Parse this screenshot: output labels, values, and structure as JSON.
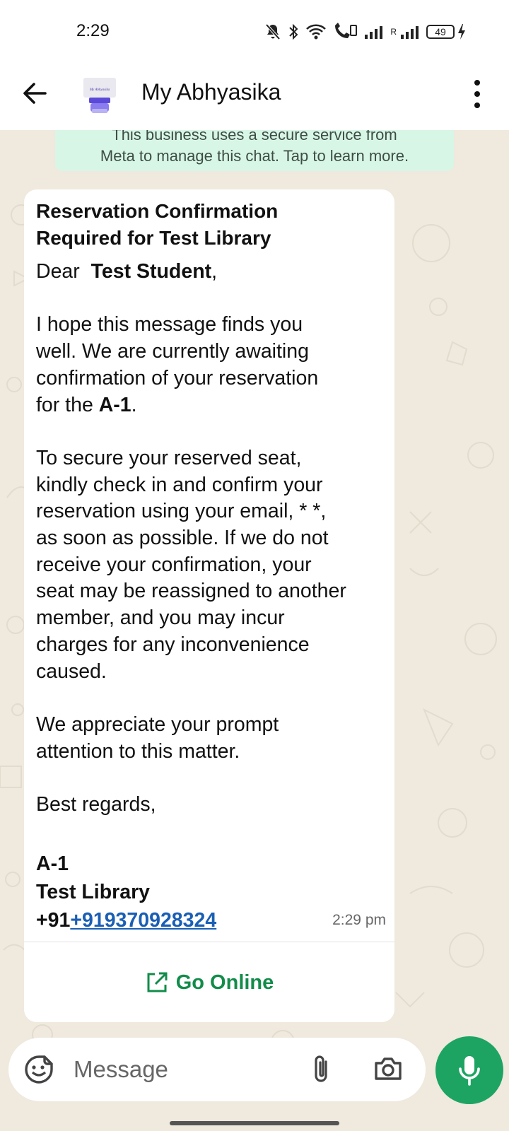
{
  "status_bar": {
    "time": "2:29",
    "battery": "49",
    "roaming_label": "R"
  },
  "header": {
    "title": "My Abhyasika",
    "avatar_text": "My Abhyasika"
  },
  "system_notice": {
    "line1": "This business uses a secure service from",
    "line2": "Meta to manage this chat. Tap to learn more."
  },
  "message": {
    "title_line1": "Reservation Confirmation",
    "title_line2": "Required for Test Library",
    "greeting_prefix": "Dear ",
    "student_name": "Test Student",
    "greeting_suffix": ",",
    "para1_line1": "I hope this message finds you",
    "para1_line2": "well. We are currently awaiting",
    "para1_line3": "confirmation of your reservation",
    "para1_line4_prefix": "for the ",
    "seat": "A-1",
    "para1_line4_suffix": ".",
    "para2_line1": "To secure your reserved seat,",
    "para2_line2": "kindly check in and confirm your",
    "para2_line3": "reservation using your email, * *,",
    "para2_line4": "as soon as possible. If we do not",
    "para2_line5": "receive your confirmation, your",
    "para2_line6": "seat may be reassigned to another",
    "para2_line7": "member, and you may incur",
    "para2_line8": "charges for any inconvenience",
    "para2_line9": "caused.",
    "para3_line1": "We appreciate your prompt",
    "para3_line2": "attention to this matter.",
    "closing": "Best regards,",
    "sign_seat": "A-1",
    "sign_library": "Test Library",
    "phone_prefix": "+91",
    "phone_link": "+919370928324",
    "time": "2:29 pm",
    "button_label": "Go Online"
  },
  "input_bar": {
    "placeholder": "Message"
  },
  "colors": {
    "chat_background": "#efe9de",
    "notice_background": "#d8f6e6",
    "accent_green": "#1da462",
    "link_blue": "#1a5fb4"
  },
  "icons": [
    "back-arrow-icon",
    "more-vert-icon",
    "external-link-icon",
    "sticker-icon",
    "attach-icon",
    "camera-icon",
    "mic-icon",
    "mute-icon",
    "bluetooth-icon",
    "wifi-icon",
    "signal-icon",
    "battery-icon",
    "charging-icon"
  ]
}
